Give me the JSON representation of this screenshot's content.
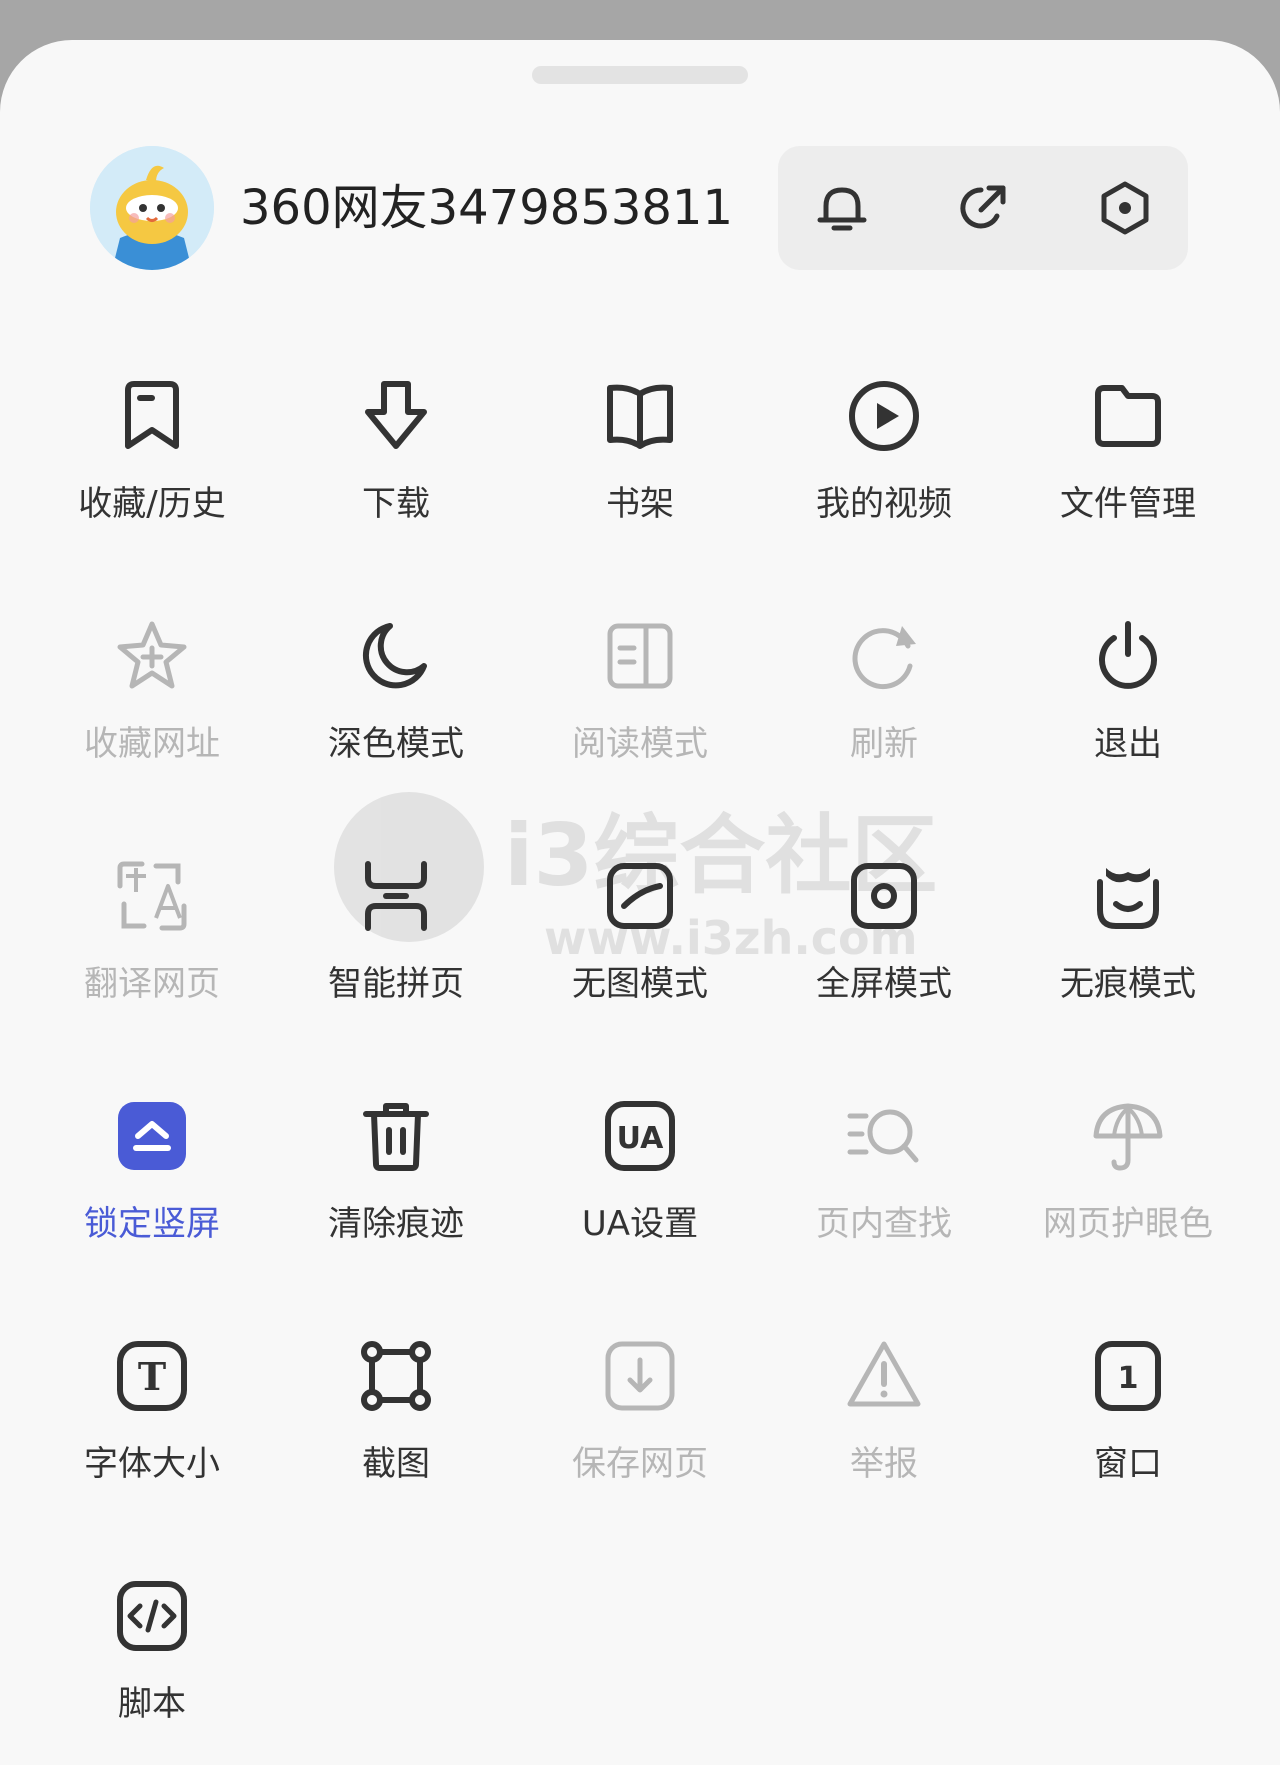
{
  "header": {
    "username": "360网友3479853811",
    "avatar_icon": "mascot-avatar-icon",
    "actions": [
      {
        "name": "notifications",
        "icon": "bell-icon"
      },
      {
        "name": "share",
        "icon": "share-arrow-icon"
      },
      {
        "name": "settings",
        "icon": "hexagon-settings-icon"
      }
    ]
  },
  "menu": {
    "rows": [
      [
        {
          "label": "收藏/历史",
          "icon": "bookmark-icon",
          "state": "normal"
        },
        {
          "label": "下载",
          "icon": "download-arrow-icon",
          "state": "normal"
        },
        {
          "label": "书架",
          "icon": "open-book-icon",
          "state": "normal"
        },
        {
          "label": "我的视频",
          "icon": "play-circle-icon",
          "state": "normal"
        },
        {
          "label": "文件管理",
          "icon": "folder-icon",
          "state": "normal"
        }
      ],
      [
        {
          "label": "收藏网址",
          "icon": "star-plus-icon",
          "state": "disabled"
        },
        {
          "label": "深色模式",
          "icon": "moon-icon",
          "state": "normal"
        },
        {
          "label": "阅读模式",
          "icon": "reader-icon",
          "state": "disabled"
        },
        {
          "label": "刷新",
          "icon": "refresh-icon",
          "state": "disabled"
        },
        {
          "label": "退出",
          "icon": "power-icon",
          "state": "normal"
        }
      ],
      [
        {
          "label": "翻译网页",
          "icon": "translate-icon",
          "state": "disabled"
        },
        {
          "label": "智能拼页",
          "icon": "page-join-icon",
          "state": "normal"
        },
        {
          "label": "无图模式",
          "icon": "no-image-icon",
          "state": "normal"
        },
        {
          "label": "全屏模式",
          "icon": "fullscreen-icon",
          "state": "normal"
        },
        {
          "label": "无痕模式",
          "icon": "incognito-mask-icon",
          "state": "normal"
        }
      ],
      [
        {
          "label": "锁定竖屏",
          "icon": "lock-portrait-icon",
          "state": "active"
        },
        {
          "label": "清除痕迹",
          "icon": "trash-icon",
          "state": "normal"
        },
        {
          "label": "UA设置",
          "icon": "ua-icon",
          "state": "normal"
        },
        {
          "label": "页内查找",
          "icon": "find-in-page-icon",
          "state": "disabled"
        },
        {
          "label": "网页护眼色",
          "icon": "umbrella-icon",
          "state": "disabled"
        }
      ],
      [
        {
          "label": "字体大小",
          "icon": "font-size-icon",
          "state": "normal"
        },
        {
          "label": "截图",
          "icon": "screenshot-icon",
          "state": "normal"
        },
        {
          "label": "保存网页",
          "icon": "save-page-icon",
          "state": "disabled"
        },
        {
          "label": "举报",
          "icon": "warning-icon",
          "state": "disabled"
        },
        {
          "label": "窗口",
          "icon": "window-count-icon",
          "state": "normal"
        }
      ],
      [
        {
          "label": "脚本",
          "icon": "script-code-icon",
          "state": "normal"
        }
      ]
    ],
    "window_count": "1",
    "ua_text": "UA",
    "font_icon_text": "T"
  },
  "watermark": {
    "text": "i3综合社区",
    "url": "www.i3zh.com"
  },
  "colors": {
    "icon": "#333333",
    "disabled": "#b6b6b6",
    "accent": "#4a5bd6"
  }
}
